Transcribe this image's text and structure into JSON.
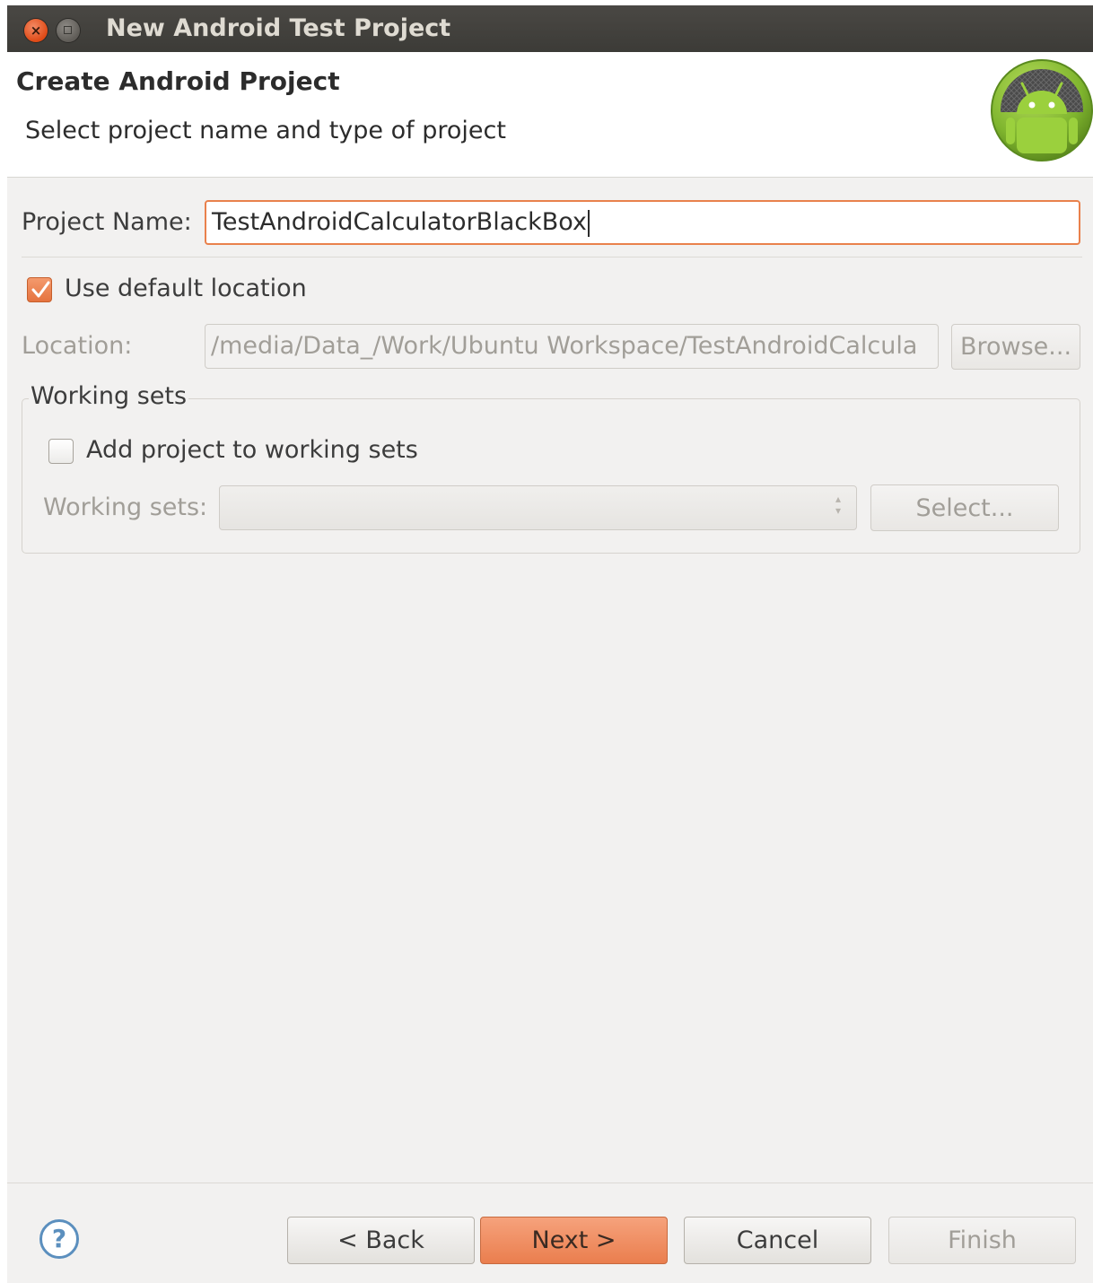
{
  "window": {
    "title": "New Android Test Project",
    "close_glyph": "×"
  },
  "banner": {
    "title": "Create Android Project",
    "subtitle": "Select project name and type of project",
    "logo_icon": "android-robot-icon"
  },
  "project_name": {
    "label": "Project Name:",
    "value": "TestAndroidCalculatorBlackBox"
  },
  "default_location": {
    "label": "Use default location",
    "checked": true
  },
  "location": {
    "label": "Location:",
    "value": "/media/Data_/Work/Ubuntu Workspace/TestAndroidCalcula",
    "browse_label": "Browse..."
  },
  "working_sets": {
    "group_title": "Working sets",
    "add_label": "Add project to working sets",
    "add_checked": false,
    "sets_label": "Working sets:",
    "selected_value": "",
    "select_button": "Select..."
  },
  "footer": {
    "help_glyph": "?",
    "back": "< Back",
    "next": "Next >",
    "cancel": "Cancel",
    "finish": "Finish"
  },
  "colors": {
    "accent": "#e9814c",
    "titlebar": "#3c3b37",
    "dialog_bg": "#f2f1f0",
    "android_green": "#8fc23a"
  }
}
